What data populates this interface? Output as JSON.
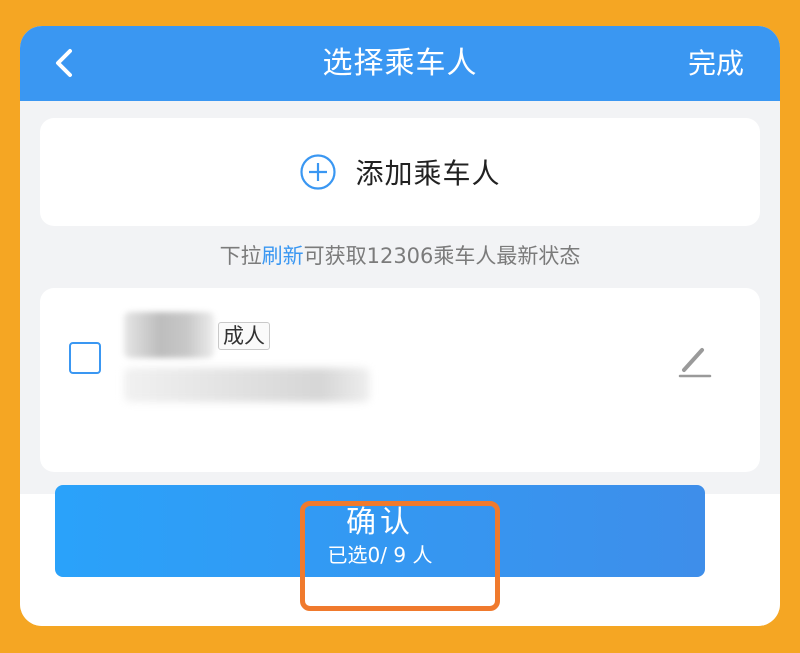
{
  "header": {
    "title": "选择乘车人",
    "done_label": "完成"
  },
  "add_passenger": {
    "label": "添加乘车人"
  },
  "hint": {
    "prefix": "下拉",
    "link": "刷新",
    "suffix": "可获取12306乘车人最新状态"
  },
  "passengers": [
    {
      "name": "",
      "type": "成人",
      "id_number": "",
      "selected": false
    }
  ],
  "confirm": {
    "label": "确认",
    "selection_status": "已选0/ 9 人"
  },
  "colors": {
    "accent": "#3A97F2",
    "page_background": "#F5A623",
    "highlight": "#F07A2D"
  }
}
